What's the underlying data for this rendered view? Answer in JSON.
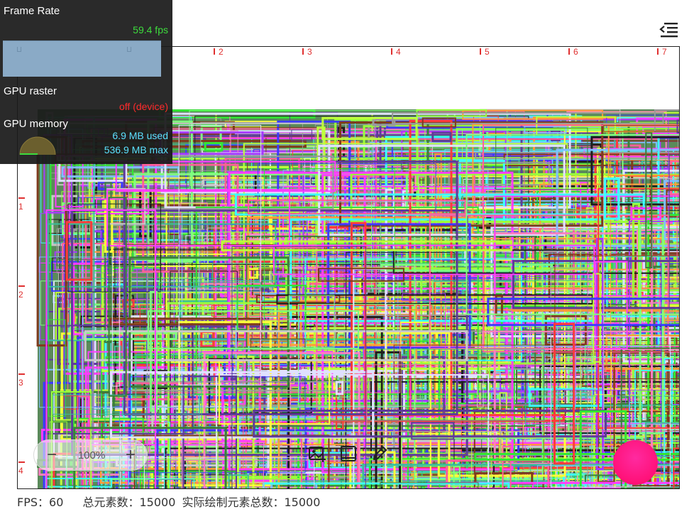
{
  "perf_hud": {
    "frame_rate_label": "Frame Rate",
    "frame_rate_value": "59.4 fps",
    "gpu_raster_label": "GPU raster",
    "gpu_raster_value": "off (device)",
    "gpu_memory_label": "GPU memory",
    "gpu_memory_used": "6.9 MB used",
    "gpu_memory_max": "536.9 MB max",
    "colors": {
      "fps": "#3ddc3d",
      "raster": "#ff2a2a",
      "memory": "#5ce1ff",
      "graph": "#8aaac6"
    },
    "gpu_memory_fraction": 0.013
  },
  "header": {
    "menu_icon": "menu-collapse-icon"
  },
  "canvas": {
    "top_ruler": [
      "2",
      "3",
      "4",
      "5",
      "6",
      "7"
    ],
    "left_ruler": [
      "1",
      "2",
      "3",
      "4"
    ],
    "ruler_color": "#e03030",
    "scene_description_colors": [
      "#ff4040",
      "#40ff40",
      "#4040ff",
      "#ff40ff",
      "#40ffff",
      "#ffff40",
      "#888888",
      "#222222",
      "#a040ff",
      "#ff9a40"
    ],
    "total_elements": 15000
  },
  "zoom": {
    "out_label": "−",
    "level": "100%",
    "in_label": "+"
  },
  "tools": [
    {
      "name": "add-image-icon"
    },
    {
      "name": "frame-icon"
    },
    {
      "name": "pencil-icon"
    }
  ],
  "fab": {
    "color": "#ff1178"
  },
  "status_bar": {
    "fps_label": "FPS：",
    "fps_value": "60",
    "total_label": "总元素数：",
    "total_value": "15000",
    "drawn_label": "实际绘制元素总数：",
    "drawn_value": "15000"
  }
}
